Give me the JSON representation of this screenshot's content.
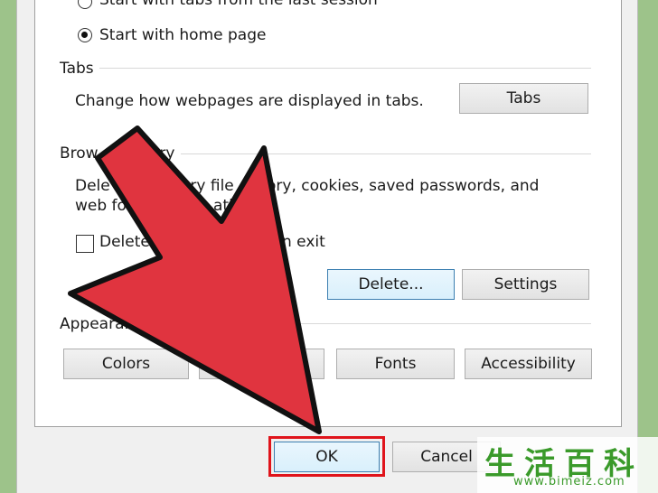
{
  "startup": {
    "option_last_session": "Start with tabs from the last session",
    "option_home_page": "Start with home page",
    "selected": "home_page"
  },
  "tabs_section": {
    "title": "Tabs",
    "description": "Change how webpages are displayed in tabs.",
    "tabs_button": "Tabs"
  },
  "history_section": {
    "title_visible_start": "Brow",
    "title_visible_end": "ory",
    "desc_line1_start": "Dele",
    "desc_line1_mid": "ary file",
    "desc_line1_end": "ory, cookies, saved passwords, and",
    "desc_line2_start": "web fo",
    "desc_line2_end": "ati",
    "checkbox_label_start": "Delete",
    "checkbox_label_end": "n exit",
    "checkbox_checked": false,
    "delete_button": "Delete...",
    "settings_button": "Settings"
  },
  "appearance_section": {
    "title_visible": "Appearan",
    "colors_button": "Colors",
    "fonts_button": "Fonts",
    "accessibility_button": "Accessibility"
  },
  "footer": {
    "ok_button": "OK",
    "cancel_button": "Cancel"
  },
  "watermark": {
    "logo": "生活百科",
    "url": "www.bimeiz.com"
  },
  "colors": {
    "arrow_fill": "#e0343f",
    "highlight": "#e0141b",
    "background": "#9dc38a"
  }
}
